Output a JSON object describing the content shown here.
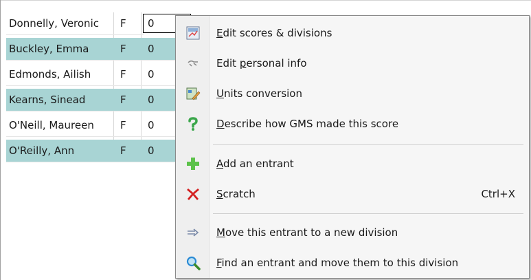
{
  "grid": {
    "rows": [
      {
        "name": "Donnelly, Veronic",
        "sex": "F",
        "score": "0",
        "alt": false,
        "editing": true
      },
      {
        "name": "Buckley, Emma",
        "sex": "F",
        "score": "0",
        "alt": true,
        "editing": false
      },
      {
        "name": "Edmonds, Ailish",
        "sex": "F",
        "score": "0",
        "alt": false,
        "editing": false
      },
      {
        "name": "Kearns, Sinead",
        "sex": "F",
        "score": "0",
        "alt": true,
        "editing": false
      },
      {
        "name": "O'Neill, Maureen",
        "sex": "F",
        "score": "0",
        "alt": false,
        "editing": false
      },
      {
        "name": "O'Reilly, Ann",
        "sex": "F",
        "score": "0",
        "alt": true,
        "editing": false
      }
    ],
    "alt_color": "#a8d4d4"
  },
  "context_menu": {
    "items": [
      {
        "pre": "",
        "key": "E",
        "post": "dit scores & divisions",
        "shortcut": "",
        "icon": "edit-scores-icon"
      },
      {
        "pre": "Edit ",
        "key": "p",
        "post": "ersonal info",
        "shortcut": "",
        "icon": "personal-info-icon"
      },
      {
        "pre": "",
        "key": "U",
        "post": "nits conversion",
        "shortcut": "",
        "icon": "units-conversion-icon"
      },
      {
        "pre": "",
        "key": "D",
        "post": "escribe how GMS made this score",
        "shortcut": "",
        "icon": "question-icon"
      },
      {
        "pre": "",
        "key": "A",
        "post": "dd an entrant",
        "shortcut": "",
        "icon": "plus-icon"
      },
      {
        "pre": "",
        "key": "S",
        "post": "cratch",
        "shortcut": "Ctrl+X",
        "icon": "scratch-x-icon"
      },
      {
        "pre": "",
        "key": "M",
        "post": "ove this entrant to a new division",
        "shortcut": "",
        "icon": "arrow-right-icon"
      },
      {
        "pre": "",
        "key": "F",
        "post": "ind an entrant and move them to this division",
        "shortcut": "",
        "icon": "magnifier-icon"
      }
    ],
    "colors": {
      "plus": "#5cc24a",
      "scratch": "#d42020",
      "question": "#3aa64a",
      "magnifier": "#2a8ad4"
    }
  }
}
